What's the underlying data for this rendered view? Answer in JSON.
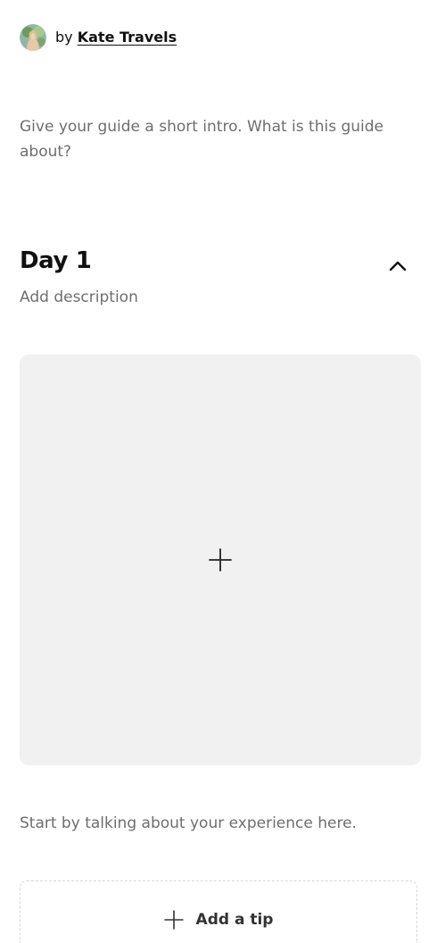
{
  "author": {
    "by_label": "by",
    "name": "Kate Travels",
    "avatar_icon": "avatar-photo"
  },
  "guide": {
    "intro_placeholder": "Give your guide a short intro. What is this guide about?"
  },
  "day": {
    "title": "Day 1",
    "description_placeholder": "Add description",
    "collapse_icon": "chevron-up-icon",
    "photo_upload_icon": "plus-icon",
    "experience_placeholder": "Start by talking about your experience here."
  },
  "tip": {
    "label": "Add a tip",
    "icon": "plus-icon"
  },
  "colors": {
    "text_primary": "#111111",
    "text_muted": "#6e6e6e",
    "upload_bg": "#f1f1f1",
    "dashed_border": "#d6d6d6"
  }
}
